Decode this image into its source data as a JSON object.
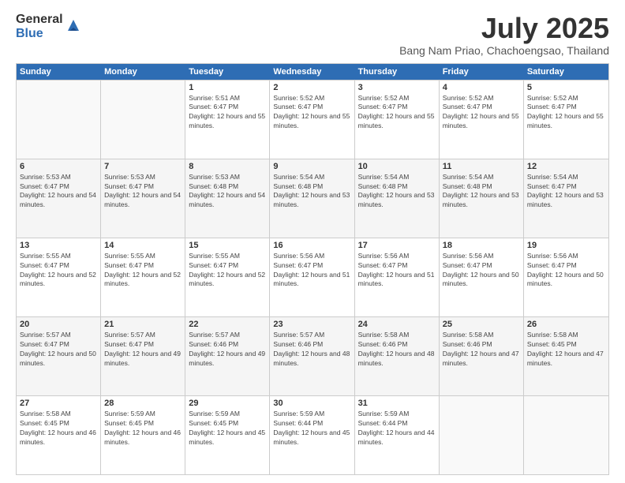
{
  "logo": {
    "general": "General",
    "blue": "Blue"
  },
  "header": {
    "month": "July 2025",
    "location": "Bang Nam Priao, Chachoengsao, Thailand"
  },
  "weekdays": [
    "Sunday",
    "Monday",
    "Tuesday",
    "Wednesday",
    "Thursday",
    "Friday",
    "Saturday"
  ],
  "rows": [
    [
      {
        "day": "",
        "empty": true
      },
      {
        "day": "",
        "empty": true
      },
      {
        "day": "1",
        "sunrise": "Sunrise: 5:51 AM",
        "sunset": "Sunset: 6:47 PM",
        "daylight": "Daylight: 12 hours and 55 minutes."
      },
      {
        "day": "2",
        "sunrise": "Sunrise: 5:52 AM",
        "sunset": "Sunset: 6:47 PM",
        "daylight": "Daylight: 12 hours and 55 minutes."
      },
      {
        "day": "3",
        "sunrise": "Sunrise: 5:52 AM",
        "sunset": "Sunset: 6:47 PM",
        "daylight": "Daylight: 12 hours and 55 minutes."
      },
      {
        "day": "4",
        "sunrise": "Sunrise: 5:52 AM",
        "sunset": "Sunset: 6:47 PM",
        "daylight": "Daylight: 12 hours and 55 minutes."
      },
      {
        "day": "5",
        "sunrise": "Sunrise: 5:52 AM",
        "sunset": "Sunset: 6:47 PM",
        "daylight": "Daylight: 12 hours and 55 minutes."
      }
    ],
    [
      {
        "day": "6",
        "sunrise": "Sunrise: 5:53 AM",
        "sunset": "Sunset: 6:47 PM",
        "daylight": "Daylight: 12 hours and 54 minutes."
      },
      {
        "day": "7",
        "sunrise": "Sunrise: 5:53 AM",
        "sunset": "Sunset: 6:47 PM",
        "daylight": "Daylight: 12 hours and 54 minutes."
      },
      {
        "day": "8",
        "sunrise": "Sunrise: 5:53 AM",
        "sunset": "Sunset: 6:48 PM",
        "daylight": "Daylight: 12 hours and 54 minutes."
      },
      {
        "day": "9",
        "sunrise": "Sunrise: 5:54 AM",
        "sunset": "Sunset: 6:48 PM",
        "daylight": "Daylight: 12 hours and 53 minutes."
      },
      {
        "day": "10",
        "sunrise": "Sunrise: 5:54 AM",
        "sunset": "Sunset: 6:48 PM",
        "daylight": "Daylight: 12 hours and 53 minutes."
      },
      {
        "day": "11",
        "sunrise": "Sunrise: 5:54 AM",
        "sunset": "Sunset: 6:48 PM",
        "daylight": "Daylight: 12 hours and 53 minutes."
      },
      {
        "day": "12",
        "sunrise": "Sunrise: 5:54 AM",
        "sunset": "Sunset: 6:47 PM",
        "daylight": "Daylight: 12 hours and 53 minutes."
      }
    ],
    [
      {
        "day": "13",
        "sunrise": "Sunrise: 5:55 AM",
        "sunset": "Sunset: 6:47 PM",
        "daylight": "Daylight: 12 hours and 52 minutes."
      },
      {
        "day": "14",
        "sunrise": "Sunrise: 5:55 AM",
        "sunset": "Sunset: 6:47 PM",
        "daylight": "Daylight: 12 hours and 52 minutes."
      },
      {
        "day": "15",
        "sunrise": "Sunrise: 5:55 AM",
        "sunset": "Sunset: 6:47 PM",
        "daylight": "Daylight: 12 hours and 52 minutes."
      },
      {
        "day": "16",
        "sunrise": "Sunrise: 5:56 AM",
        "sunset": "Sunset: 6:47 PM",
        "daylight": "Daylight: 12 hours and 51 minutes."
      },
      {
        "day": "17",
        "sunrise": "Sunrise: 5:56 AM",
        "sunset": "Sunset: 6:47 PM",
        "daylight": "Daylight: 12 hours and 51 minutes."
      },
      {
        "day": "18",
        "sunrise": "Sunrise: 5:56 AM",
        "sunset": "Sunset: 6:47 PM",
        "daylight": "Daylight: 12 hours and 50 minutes."
      },
      {
        "day": "19",
        "sunrise": "Sunrise: 5:56 AM",
        "sunset": "Sunset: 6:47 PM",
        "daylight": "Daylight: 12 hours and 50 minutes."
      }
    ],
    [
      {
        "day": "20",
        "sunrise": "Sunrise: 5:57 AM",
        "sunset": "Sunset: 6:47 PM",
        "daylight": "Daylight: 12 hours and 50 minutes."
      },
      {
        "day": "21",
        "sunrise": "Sunrise: 5:57 AM",
        "sunset": "Sunset: 6:47 PM",
        "daylight": "Daylight: 12 hours and 49 minutes."
      },
      {
        "day": "22",
        "sunrise": "Sunrise: 5:57 AM",
        "sunset": "Sunset: 6:46 PM",
        "daylight": "Daylight: 12 hours and 49 minutes."
      },
      {
        "day": "23",
        "sunrise": "Sunrise: 5:57 AM",
        "sunset": "Sunset: 6:46 PM",
        "daylight": "Daylight: 12 hours and 48 minutes."
      },
      {
        "day": "24",
        "sunrise": "Sunrise: 5:58 AM",
        "sunset": "Sunset: 6:46 PM",
        "daylight": "Daylight: 12 hours and 48 minutes."
      },
      {
        "day": "25",
        "sunrise": "Sunrise: 5:58 AM",
        "sunset": "Sunset: 6:46 PM",
        "daylight": "Daylight: 12 hours and 47 minutes."
      },
      {
        "day": "26",
        "sunrise": "Sunrise: 5:58 AM",
        "sunset": "Sunset: 6:45 PM",
        "daylight": "Daylight: 12 hours and 47 minutes."
      }
    ],
    [
      {
        "day": "27",
        "sunrise": "Sunrise: 5:58 AM",
        "sunset": "Sunset: 6:45 PM",
        "daylight": "Daylight: 12 hours and 46 minutes."
      },
      {
        "day": "28",
        "sunrise": "Sunrise: 5:59 AM",
        "sunset": "Sunset: 6:45 PM",
        "daylight": "Daylight: 12 hours and 46 minutes."
      },
      {
        "day": "29",
        "sunrise": "Sunrise: 5:59 AM",
        "sunset": "Sunset: 6:45 PM",
        "daylight": "Daylight: 12 hours and 45 minutes."
      },
      {
        "day": "30",
        "sunrise": "Sunrise: 5:59 AM",
        "sunset": "Sunset: 6:44 PM",
        "daylight": "Daylight: 12 hours and 45 minutes."
      },
      {
        "day": "31",
        "sunrise": "Sunrise: 5:59 AM",
        "sunset": "Sunset: 6:44 PM",
        "daylight": "Daylight: 12 hours and 44 minutes."
      },
      {
        "day": "",
        "empty": true
      },
      {
        "day": "",
        "empty": true
      }
    ]
  ]
}
